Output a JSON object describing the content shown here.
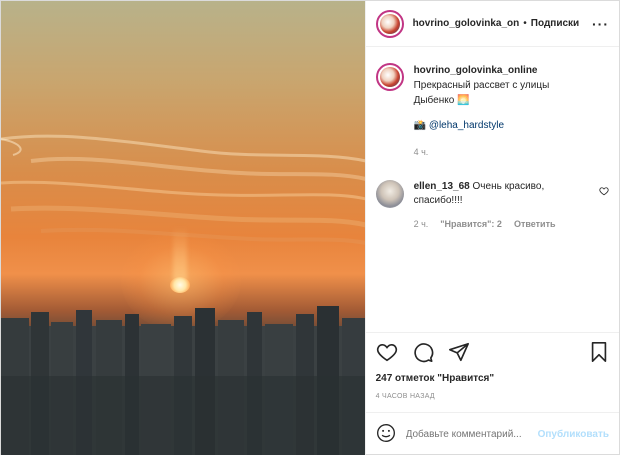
{
  "post": {
    "author": "hovrino_golovinka_online",
    "header_author": "hovrino_golovinka_on",
    "header_separator": "•",
    "follow_label": "Подписки",
    "more_label": "···",
    "caption": {
      "username": "hovrino_golovinka_online",
      "line1": "Прекрасный рассвет с улицы",
      "line2": "Дыбенко 🌅",
      "mention_prefix": "📸",
      "mention": "@leha_hardstyle",
      "time": "4 ч."
    },
    "comments": [
      {
        "username": "ellen_13_68",
        "text": "Очень красиво, спасибо!!!!",
        "time": "2 ч.",
        "likes": "\"Нравится\": 2",
        "reply_label": "Ответить"
      }
    ],
    "likes_text": "247 отметок \"Нравится\"",
    "posted_time": "4 часов назад",
    "add_comment": {
      "placeholder": "Добавьте комментарий...",
      "publish_label": "Опубликовать"
    }
  },
  "colors": {
    "accent_link": "#00376b",
    "publish_disabled": "#b2dffc",
    "muted_text": "#8e8e8e"
  },
  "icons": [
    "more-icon",
    "heart-icon",
    "comment-icon",
    "share-icon",
    "bookmark-icon",
    "emoji-icon",
    "comment-heart-icon"
  ]
}
